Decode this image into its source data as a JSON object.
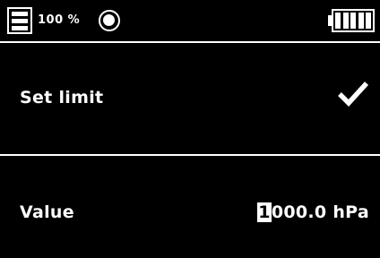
{
  "status_bar": {
    "level": "100 %",
    "icons": {
      "memory": "document-icon",
      "recording": "record-icon",
      "battery": "battery-full-icon"
    },
    "battery_cells": 5
  },
  "limit_row": {
    "label": "Set limit",
    "state_icon": "check-icon"
  },
  "value_row": {
    "label": "Value",
    "value_edit_digit": "1",
    "value_rest": "000.0 hPa"
  }
}
